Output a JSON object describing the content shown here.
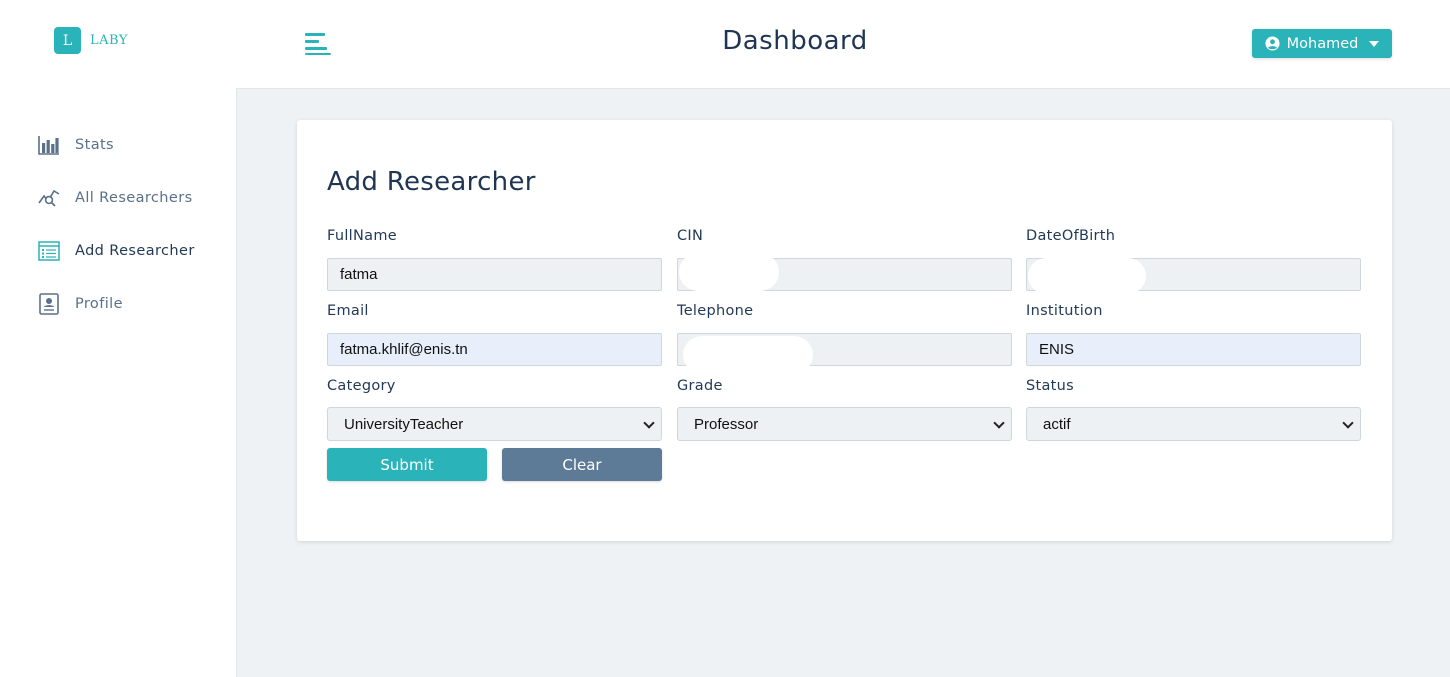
{
  "brand": {
    "letter": "L",
    "name": "LABY",
    "color": "#2ab3b8"
  },
  "header": {
    "title": "Dashboard",
    "menu_icon": "hamburger-icon"
  },
  "user_menu": {
    "name": "Mohamed",
    "icon": "user-circle-icon"
  },
  "sidebar": {
    "items": [
      {
        "label": "Stats",
        "icon": "bar-chart-icon",
        "active": false
      },
      {
        "label": "All Researchers",
        "icon": "line-chart-search-icon",
        "active": false
      },
      {
        "label": "Add Researcher",
        "icon": "form-list-icon",
        "active": true
      },
      {
        "label": "Profile",
        "icon": "id-card-icon",
        "active": false
      }
    ]
  },
  "form": {
    "title": "Add Researcher",
    "fields": {
      "fullname": {
        "label": "FullName",
        "value": "fatma"
      },
      "cin": {
        "label": "CIN",
        "value": ""
      },
      "dob": {
        "label": "DateOfBirth",
        "value": ""
      },
      "email": {
        "label": "Email",
        "value": "fatma.khlif@enis.tn"
      },
      "telephone": {
        "label": "Telephone",
        "value": ""
      },
      "institution": {
        "label": "Institution",
        "value": "ENIS"
      },
      "category": {
        "label": "Category",
        "value": "UniversityTeacher"
      },
      "grade": {
        "label": "Grade",
        "value": "Professor"
      },
      "status": {
        "label": "Status",
        "value": "actif"
      }
    },
    "submit_label": "Submit",
    "clear_label": "Clear"
  },
  "colors": {
    "accent": "#2ab3b8",
    "secondary": "#5d7a96",
    "background": "#eff2f4",
    "text": "#233a57"
  }
}
